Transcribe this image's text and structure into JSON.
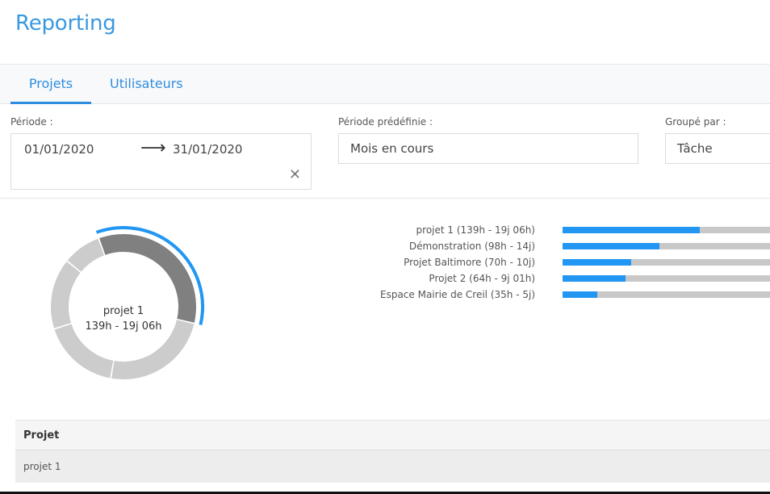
{
  "page": {
    "title": "Reporting"
  },
  "tabs": [
    {
      "label": "Projets",
      "active": true
    },
    {
      "label": "Utilisateurs",
      "active": false
    }
  ],
  "filters": {
    "period": {
      "label": "Période :",
      "start": "01/01/2020",
      "arrow": "⟶",
      "end": "31/01/2020",
      "clear": "✕"
    },
    "predefined": {
      "label": "Période prédéfinie :",
      "value": "Mois en cours"
    },
    "group_by": {
      "label": "Groupé par :",
      "value": "Tâche"
    }
  },
  "donut": {
    "center_title": "projet 1",
    "center_value": "139h - 19j 06h",
    "highlight_color": "#2196f3",
    "active_color": "#808080",
    "inactive_color": "#cccccc"
  },
  "chart_data": {
    "type": "bar",
    "orientation": "horizontal",
    "categories": [
      "projet 1 (139h - 19j 06h)",
      "Démonstration (98h - 14j)",
      "Projet Baltimore (70h - 10j)",
      "Projet 2 (64h - 9j 01h)",
      "Espace Mairie de Creil (35h - 5j)"
    ],
    "values": [
      139,
      98,
      70,
      64,
      35
    ],
    "unit": "h",
    "fill_color": "#2196f3",
    "track_color": "#c8c8c8"
  },
  "table": {
    "columns": [
      "Projet"
    ],
    "rows": [
      [
        "projet 1"
      ]
    ]
  }
}
